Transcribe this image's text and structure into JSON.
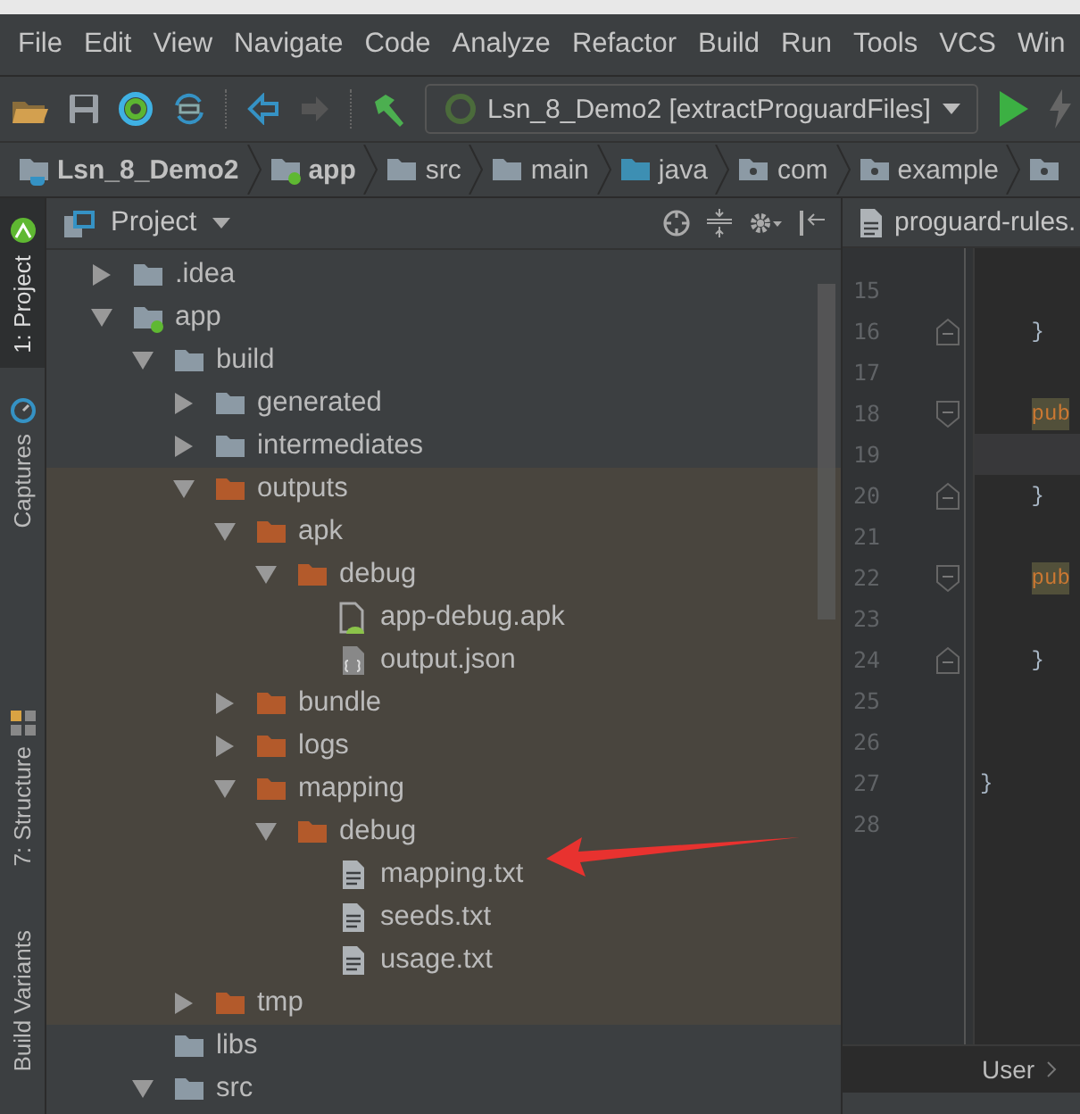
{
  "menu": [
    {
      "label": "File"
    },
    {
      "label": "Edit"
    },
    {
      "label": "View"
    },
    {
      "label": "Navigate"
    },
    {
      "label": "Code"
    },
    {
      "label": "Analyze"
    },
    {
      "label": "Refactor"
    },
    {
      "label": "Build"
    },
    {
      "label": "Run"
    },
    {
      "label": "Tools"
    },
    {
      "label": "VCS"
    },
    {
      "label": "Win"
    }
  ],
  "toolbar": {
    "run_config": "Lsn_8_Demo2 [extractProguardFiles]"
  },
  "breadcrumbs": [
    {
      "label": "Lsn_8_Demo2",
      "kind": "project"
    },
    {
      "label": "app",
      "kind": "module"
    },
    {
      "label": "src",
      "kind": "folder"
    },
    {
      "label": "main",
      "kind": "folder"
    },
    {
      "label": "java",
      "kind": "source"
    },
    {
      "label": "com",
      "kind": "package"
    },
    {
      "label": "example",
      "kind": "package"
    },
    {
      "kind": "package"
    }
  ],
  "side_tabs": [
    {
      "label": "1: Project",
      "selected": true,
      "kind": "android"
    },
    {
      "label": "Captures",
      "selected": false,
      "kind": "captures"
    },
    {
      "label": "7: Structure",
      "selected": false,
      "kind": "structure"
    },
    {
      "label": "Build Variants",
      "selected": false,
      "kind": "plain"
    }
  ],
  "project_panel": {
    "title": "Project",
    "tree": [
      {
        "label": ".idea",
        "kind": "folder",
        "color": "#8c9aa5",
        "expanded": false,
        "highlighted": false
      },
      {
        "label": "app",
        "kind": "module",
        "color": "#8c9aa5",
        "expanded": true,
        "highlighted": false,
        "children": [
          {
            "label": "build",
            "kind": "folder",
            "color": "#8c9aa5",
            "expanded": true,
            "highlighted": false,
            "children": [
              {
                "label": "generated",
                "kind": "folder",
                "color": "#8c9aa5",
                "expanded": false,
                "highlighted": false
              },
              {
                "label": "intermediates",
                "kind": "folder",
                "color": "#8c9aa5",
                "expanded": false,
                "highlighted": false
              },
              {
                "label": "outputs",
                "kind": "folder",
                "color": "#b35a2b",
                "expanded": true,
                "highlighted": true,
                "children": [
                  {
                    "label": "apk",
                    "kind": "folder",
                    "color": "#b35a2b",
                    "expanded": true,
                    "highlighted": true,
                    "children": [
                      {
                        "label": "debug",
                        "kind": "folder",
                        "color": "#b35a2b",
                        "expanded": true,
                        "highlighted": true,
                        "children": [
                          {
                            "label": "app-debug.apk",
                            "kind": "apk",
                            "highlighted": true
                          },
                          {
                            "label": "output.json",
                            "kind": "json",
                            "highlighted": true
                          }
                        ]
                      }
                    ]
                  },
                  {
                    "label": "bundle",
                    "kind": "folder",
                    "color": "#b35a2b",
                    "expanded": false,
                    "highlighted": true
                  },
                  {
                    "label": "logs",
                    "kind": "folder",
                    "color": "#b35a2b",
                    "expanded": false,
                    "highlighted": true
                  },
                  {
                    "label": "mapping",
                    "kind": "folder",
                    "color": "#b35a2b",
                    "expanded": true,
                    "highlighted": true,
                    "children": [
                      {
                        "label": "debug",
                        "kind": "folder",
                        "color": "#b35a2b",
                        "expanded": true,
                        "highlighted": true,
                        "children": [
                          {
                            "label": "mapping.txt",
                            "kind": "file",
                            "highlighted": true
                          },
                          {
                            "label": "seeds.txt",
                            "kind": "file",
                            "highlighted": true
                          },
                          {
                            "label": "usage.txt",
                            "kind": "file",
                            "highlighted": true
                          }
                        ]
                      }
                    ]
                  }
                ]
              },
              {
                "label": "tmp",
                "kind": "folder",
                "color": "#b35a2b",
                "expanded": false,
                "highlighted": true
              }
            ]
          },
          {
            "label": "libs",
            "kind": "folder",
            "color": "#8c9aa5",
            "highlighted": false
          },
          {
            "label": "src",
            "kind": "folder",
            "color": "#8c9aa5",
            "expanded": true,
            "highlighted": false
          }
        ]
      }
    ]
  },
  "editor": {
    "tab": "proguard-rules.",
    "lines": [
      {
        "number": "15",
        "fold_start": false,
        "fold_end": false,
        "current": false
      },
      {
        "number": "16",
        "fold_start": false,
        "fold_end": true,
        "current": false,
        "code": {
          "text": "    }",
          "kind": "plain"
        }
      },
      {
        "number": "17",
        "fold_start": false,
        "fold_end": false,
        "current": false
      },
      {
        "number": "18",
        "fold_start": true,
        "fold_end": false,
        "current": false,
        "code": {
          "text": "    pub",
          "kind": "keyword"
        }
      },
      {
        "number": "19",
        "fold_start": false,
        "fold_end": false,
        "current": true
      },
      {
        "number": "20",
        "fold_start": false,
        "fold_end": true,
        "current": false,
        "code": {
          "text": "    }",
          "kind": "plain"
        }
      },
      {
        "number": "21",
        "fold_start": false,
        "fold_end": false,
        "current": false
      },
      {
        "number": "22",
        "fold_start": true,
        "fold_end": false,
        "current": false,
        "code": {
          "text": "    pub",
          "kind": "keyword"
        }
      },
      {
        "number": "23",
        "fold_start": false,
        "fold_end": false,
        "current": false
      },
      {
        "number": "24",
        "fold_start": false,
        "fold_end": true,
        "current": false,
        "code": {
          "text": "    }",
          "kind": "plain"
        }
      },
      {
        "number": "25",
        "fold_start": false,
        "fold_end": false,
        "current": false
      },
      {
        "number": "26",
        "fold_start": false,
        "fold_end": false,
        "current": false
      },
      {
        "number": "27",
        "fold_start": false,
        "fold_end": false,
        "current": false,
        "code": {
          "text": "}",
          "kind": "plain"
        }
      },
      {
        "number": "28",
        "fold_start": false,
        "fold_end": false,
        "current": false
      }
    ],
    "breadcrumb": [
      "User"
    ]
  }
}
